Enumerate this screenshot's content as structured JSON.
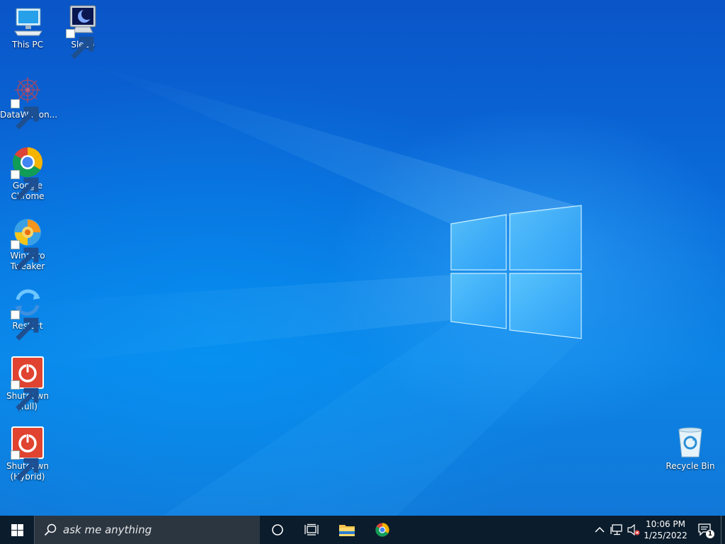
{
  "desktop_icons": {
    "this_pc": "This PC",
    "sleep": "Sleep",
    "datawagon": "DataWagon...",
    "google_chrome": "Google Chrome",
    "winaero_tweaker": "Winaero Tweaker",
    "restart": "Restart",
    "shutdown_full": "Shutdown (full)",
    "shutdown_hybrid": "Shutdown (Hybrid)",
    "recycle_bin": "Recycle Bin"
  },
  "taskbar": {
    "search_placeholder": "ask me anything",
    "pinned_apps": [
      "cortana-icon",
      "task-view-icon",
      "file-explorer-icon",
      "google-chrome-icon"
    ]
  },
  "system_tray": {
    "time": "10:06 PM",
    "date": "1/25/2022",
    "notification_count": "1",
    "icons": [
      "show-hidden-icons-chevron",
      "network-icon",
      "volume-muted-icon"
    ]
  },
  "colors": {
    "desktop_background": "#0a6ad8",
    "taskbar": "#0b1c2c",
    "search_box": "#2b3641"
  }
}
